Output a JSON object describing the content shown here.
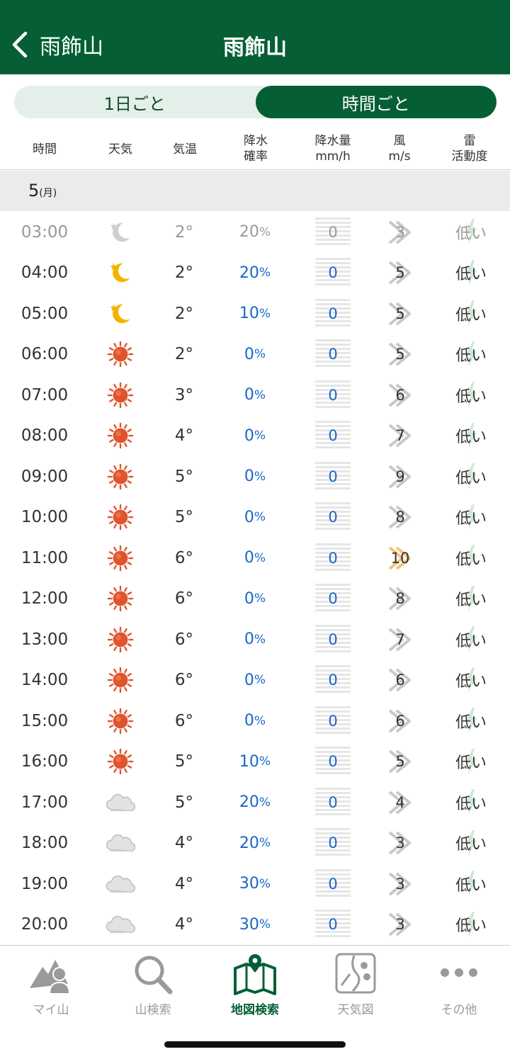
{
  "header": {
    "back_label": "雨飾山",
    "title": "雨飾山"
  },
  "segment": {
    "daily": "1日ごと",
    "hourly": "時間ごと",
    "selected": "hourly"
  },
  "columns": {
    "time": "時間",
    "weather": "天気",
    "temp": "気温",
    "pop_1": "降水",
    "pop_2": "確率",
    "rain_1": "降水量",
    "rain_2": "mm/h",
    "wind_1": "風",
    "wind_2": "m/s",
    "thunder_1": "雷",
    "thunder_2": "活動度"
  },
  "date": {
    "day": "5",
    "dow": "(月)"
  },
  "rows": [
    {
      "time": "03:00",
      "weather": "moon-icon",
      "temp": "2°",
      "pop": "20",
      "pct": "%",
      "rain": "0",
      "wind": "3",
      "thunder": "低い",
      "past": true
    },
    {
      "time": "04:00",
      "weather": "moon-icon",
      "temp": "2°",
      "pop": "20",
      "pct": "%",
      "rain": "0",
      "wind": "5",
      "thunder": "低い"
    },
    {
      "time": "05:00",
      "weather": "moon-icon",
      "temp": "2°",
      "pop": "10",
      "pct": "%",
      "rain": "0",
      "wind": "5",
      "thunder": "低い"
    },
    {
      "time": "06:00",
      "weather": "sun-icon",
      "temp": "2°",
      "pop": "0",
      "pct": "%",
      "rain": "0",
      "wind": "5",
      "thunder": "低い"
    },
    {
      "time": "07:00",
      "weather": "sun-icon",
      "temp": "3°",
      "pop": "0",
      "pct": "%",
      "rain": "0",
      "wind": "6",
      "thunder": "低い"
    },
    {
      "time": "08:00",
      "weather": "sun-icon",
      "temp": "4°",
      "pop": "0",
      "pct": "%",
      "rain": "0",
      "wind": "7",
      "thunder": "低い"
    },
    {
      "time": "09:00",
      "weather": "sun-icon",
      "temp": "5°",
      "pop": "0",
      "pct": "%",
      "rain": "0",
      "wind": "9",
      "thunder": "低い"
    },
    {
      "time": "10:00",
      "weather": "sun-icon",
      "temp": "5°",
      "pop": "0",
      "pct": "%",
      "rain": "0",
      "wind": "8",
      "thunder": "低い"
    },
    {
      "time": "11:00",
      "weather": "sun-icon",
      "temp": "6°",
      "pop": "0",
      "pct": "%",
      "rain": "0",
      "wind": "10",
      "thunder": "低い",
      "wind_strong": true
    },
    {
      "time": "12:00",
      "weather": "sun-icon",
      "temp": "6°",
      "pop": "0",
      "pct": "%",
      "rain": "0",
      "wind": "8",
      "thunder": "低い"
    },
    {
      "time": "13:00",
      "weather": "sun-icon",
      "temp": "6°",
      "pop": "0",
      "pct": "%",
      "rain": "0",
      "wind": "7",
      "thunder": "低い"
    },
    {
      "time": "14:00",
      "weather": "sun-icon",
      "temp": "6°",
      "pop": "0",
      "pct": "%",
      "rain": "0",
      "wind": "6",
      "thunder": "低い"
    },
    {
      "time": "15:00",
      "weather": "sun-icon",
      "temp": "6°",
      "pop": "0",
      "pct": "%",
      "rain": "0",
      "wind": "6",
      "thunder": "低い"
    },
    {
      "time": "16:00",
      "weather": "sun-icon",
      "temp": "5°",
      "pop": "10",
      "pct": "%",
      "rain": "0",
      "wind": "5",
      "thunder": "低い"
    },
    {
      "time": "17:00",
      "weather": "cloud-icon",
      "temp": "5°",
      "pop": "20",
      "pct": "%",
      "rain": "0",
      "wind": "4",
      "thunder": "低い"
    },
    {
      "time": "18:00",
      "weather": "cloud-icon",
      "temp": "4°",
      "pop": "20",
      "pct": "%",
      "rain": "0",
      "wind": "3",
      "thunder": "低い"
    },
    {
      "time": "19:00",
      "weather": "cloud-icon",
      "temp": "4°",
      "pop": "30",
      "pct": "%",
      "rain": "0",
      "wind": "3",
      "thunder": "低い"
    },
    {
      "time": "20:00",
      "weather": "cloud-icon",
      "temp": "4°",
      "pop": "30",
      "pct": "%",
      "rain": "0",
      "wind": "3",
      "thunder": "低い"
    }
  ],
  "tabs": [
    {
      "label": "マイ山",
      "icon": "my-mountain-icon"
    },
    {
      "label": "山検索",
      "icon": "search-icon"
    },
    {
      "label": "地図検索",
      "icon": "map-pin-icon",
      "active": true
    },
    {
      "label": "天気図",
      "icon": "weather-map-icon"
    },
    {
      "label": "その他",
      "icon": "more-icon"
    }
  ],
  "colors": {
    "brand": "#065f34",
    "precip": "#1a66c9",
    "sun": "#e0542d",
    "moon": "#f2b400"
  }
}
